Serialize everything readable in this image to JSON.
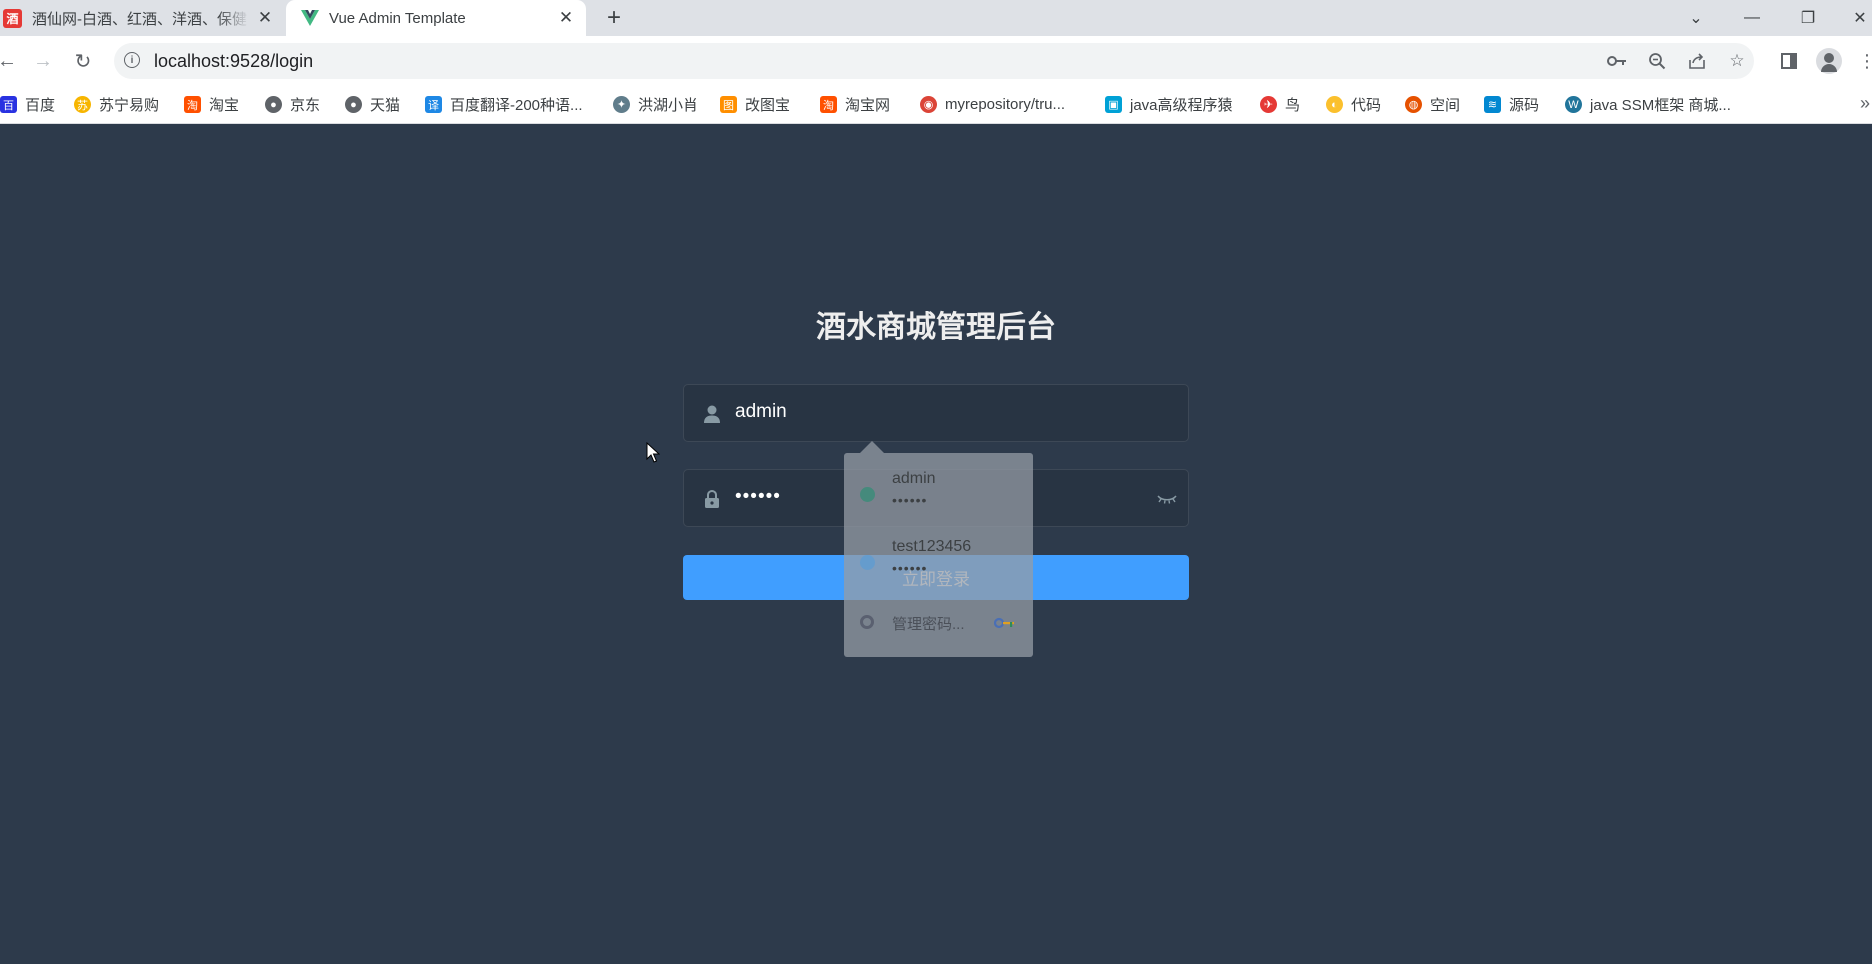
{
  "browser": {
    "tabs": [
      {
        "title": "酒仙网-白酒、红酒、洋酒、保健",
        "favicon": "酒",
        "favicon_color": "#e53935",
        "active": false
      },
      {
        "title": "Vue Admin Template",
        "favicon": "V",
        "favicon_color": "#42b983",
        "active": true
      }
    ],
    "new_tab_symbol": "+",
    "close_symbol": "✕",
    "window_controls": {
      "dropdown": "⌄",
      "minimize": "—",
      "restore": "❐",
      "close": "✕"
    },
    "url": "localhost:9528/login",
    "info_symbol": "i"
  },
  "bookmarks": [
    {
      "label": "百度",
      "icon": "baidu-icon",
      "color": "#2932e1",
      "glyph": "百"
    },
    {
      "label": "苏宁易购",
      "icon": "suning-icon",
      "color": "#f7b500",
      "glyph": "苏"
    },
    {
      "label": "淘宝",
      "icon": "taobao-icon",
      "color": "#ff5000",
      "glyph": "淘"
    },
    {
      "label": "京东",
      "icon": "globe-icon",
      "color": "#5f6368",
      "glyph": "●"
    },
    {
      "label": "天猫",
      "icon": "globe-icon",
      "color": "#5f6368",
      "glyph": "●"
    },
    {
      "label": "百度翻译-200种语...",
      "icon": "translate-icon",
      "color": "#1e88e5",
      "glyph": "译"
    },
    {
      "label": "洪湖小肖",
      "icon": "bird-icon",
      "color": "#607d8b",
      "glyph": "✦"
    },
    {
      "label": "改图宝",
      "icon": "gaitubao-icon",
      "color": "#ff8f00",
      "glyph": "图"
    },
    {
      "label": "淘宝网",
      "icon": "taobao-icon",
      "color": "#ff5000",
      "glyph": "淘"
    },
    {
      "label": "myrepository/tru...",
      "icon": "chrome-icon",
      "color": "#db4437",
      "glyph": "◉"
    },
    {
      "label": "java高级程序猿",
      "icon": "bilibili-icon",
      "color": "#00a1d6",
      "glyph": "▣"
    },
    {
      "label": "鸟",
      "icon": "bird-red-icon",
      "color": "#e53935",
      "glyph": "✈"
    },
    {
      "label": "代码",
      "icon": "code-icon",
      "color": "#fbc02d",
      "glyph": "◐"
    },
    {
      "label": "空间",
      "icon": "space-icon",
      "color": "#e65100",
      "glyph": "◍"
    },
    {
      "label": "源码",
      "icon": "docker-icon",
      "color": "#0288d1",
      "glyph": "≋"
    },
    {
      "label": "java SSM框架 商城...",
      "icon": "wordpress-icon",
      "color": "#21759b",
      "glyph": "W"
    }
  ],
  "bookmarks_more": "»",
  "login": {
    "title": "酒水商城管理后台",
    "username_value": "admin",
    "password_value": "••••••",
    "submit_label": "立即登录"
  },
  "autofill": {
    "entries": [
      {
        "username": "admin",
        "password": "••••••"
      },
      {
        "username": "test123456",
        "password": "••••••"
      }
    ],
    "manage_label": "管理密码..."
  },
  "colors": {
    "page_bg": "#2d3a4b",
    "input_bg": "#283443",
    "button": "#409eff",
    "title": "#eeeeee"
  }
}
